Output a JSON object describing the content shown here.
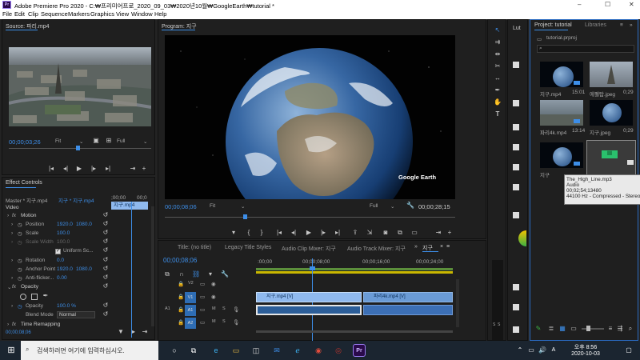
{
  "window": {
    "title": "Adobe Premiere Pro 2020 - C:₩프리미어프로_2020_09_03₩2020년10월₩GoogleEarth₩tutorial *"
  },
  "menu": [
    "File",
    "Edit",
    "Clip",
    "Sequence",
    "Markers",
    "Graphics",
    "View",
    "Window",
    "Help"
  ],
  "source": {
    "tab": "Source: 파리.mp4",
    "timecode": "00;00;03;26",
    "fit": "Fit",
    "quality": "Full"
  },
  "effect_controls": {
    "tab": "Effect Controls",
    "master": "Master * 지구.mp4",
    "sequence": "지구 * 지구.mp4",
    "ruler_start": ";00;00",
    "ruler_end": "00;0",
    "clip_label": "지구.mp4",
    "section_video": "Video",
    "motion": "Motion",
    "position": {
      "label": "Position",
      "x": "1920.0",
      "y": "1080.0"
    },
    "scale": {
      "label": "Scale",
      "value": "100.0"
    },
    "scale_width": {
      "label": "Scale Width",
      "value": "100.0"
    },
    "uniform": "Uniform Sc...",
    "rotation": {
      "label": "Rotation",
      "value": "0.0"
    },
    "anchor": {
      "label": "Anchor Point",
      "x": "1920.0",
      "y": "1080.0"
    },
    "anti": {
      "label": "Anti-flicker...",
      "value": "0.00"
    },
    "opacity_section": "Opacity",
    "opacity": {
      "label": "Opacity",
      "value": "100.0 %"
    },
    "blend": {
      "label": "Blend Mode",
      "value": "Normal"
    },
    "time_remap": "Time Remapping",
    "bottom_tc": "00;00;08;06"
  },
  "program": {
    "tab": "Program: 지구",
    "watermark": "Google Earth",
    "timecode": "00;00;08;06",
    "fit": "Fit",
    "quality": "Full",
    "duration": "00;00;28;15"
  },
  "timeline": {
    "tabs": [
      "Title: (no title)",
      "Legacy Title Styles",
      "Audio Clip Mixer: 지구",
      "Audio Track Mixer: 지구",
      "지구"
    ],
    "timecode": "00;00;08;06",
    "ruler": [
      ":00;00",
      "00;00;08;00",
      "00;00;16;00",
      "00;00;24;00"
    ],
    "tracks": {
      "v2": "V2",
      "v1": "V1",
      "a1": "A1",
      "a2": "A2",
      "m": "M",
      "s": "S"
    },
    "clip1": "지구.mp4 [V]",
    "clip2": "파리4k.mp4 [V]"
  },
  "meter": {
    "labels": [
      "S",
      "S"
    ]
  },
  "lumetri": {
    "tab": "Lut"
  },
  "project": {
    "tab": "Project: tutorial",
    "tab2": "Libraries",
    "file": "tutorial.prproj",
    "search_placeholder": "",
    "items": [
      {
        "name": "지구.mp4",
        "dur": "15:01"
      },
      {
        "name": "에펠탑.jpeg",
        "dur": "0;29"
      },
      {
        "name": "파리4k.mp4",
        "dur": "13:14"
      },
      {
        "name": "지구.jpeg",
        "dur": "0;29"
      },
      {
        "name": "지구",
        "dur": ""
      },
      {
        "name": "The_High_Line.mp3",
        "dur": ""
      }
    ],
    "tooltip": {
      "name": "The_High_Line.mp3",
      "type": "Audio",
      "duration": "00;02;54;13480",
      "info": "44100 Hz - Compressed - Stereo"
    }
  },
  "taskbar": {
    "search_placeholder": "검색하려면 여기에 입력하십시오.",
    "time": "오후 8:56",
    "date": "2020-10-03"
  }
}
